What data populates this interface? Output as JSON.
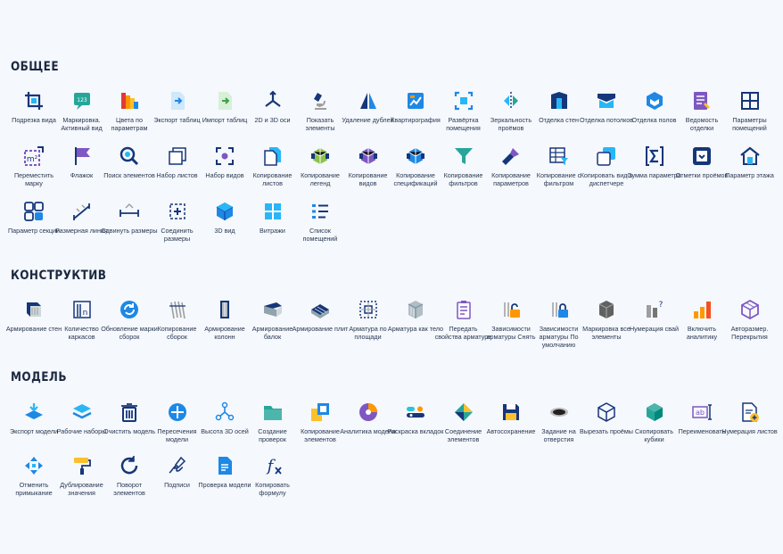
{
  "sections": [
    {
      "title": "ОБЩЕЕ",
      "tools": [
        {
          "label": "Подрезка вида",
          "icon": "crop-icon",
          "kind": "crop"
        },
        {
          "label": "Маркировка. Активный вид",
          "icon": "marking-icon",
          "kind": "badge123"
        },
        {
          "label": "Цвета по параметрам",
          "icon": "color-palette-icon",
          "kind": "palette"
        },
        {
          "label": "Экспорт таблиц",
          "icon": "export-table-icon",
          "kind": "docin"
        },
        {
          "label": "Импорт таблиц",
          "icon": "import-table-icon",
          "kind": "docout"
        },
        {
          "label": "2D и 3D оси",
          "icon": "axes-icon",
          "kind": "axes"
        },
        {
          "label": "Показать элементы",
          "icon": "microscope-icon",
          "kind": "microscope"
        },
        {
          "label": "Удаление дублей",
          "icon": "mirror-triangle-icon",
          "kind": "mirrortri"
        },
        {
          "label": "Квартирография",
          "icon": "apartment-chart-icon",
          "kind": "chart"
        },
        {
          "label": "Развёртка помещения",
          "icon": "room-unfold-icon",
          "kind": "unfold"
        },
        {
          "label": "Зеркальность проёмов",
          "icon": "mirror-opening-icon",
          "kind": "mirror"
        },
        {
          "label": "Отделка стен",
          "icon": "wall-finish-icon",
          "kind": "wallfin"
        },
        {
          "label": "Отделка потолков",
          "icon": "ceiling-finish-icon",
          "kind": "ceiling"
        },
        {
          "label": "Отделка полов",
          "icon": "floor-finish-icon",
          "kind": "floorfin"
        },
        {
          "label": "Ведомость отделки",
          "icon": "finish-schedule-icon",
          "kind": "schedule"
        },
        {
          "label": "Параметры помещений",
          "icon": "room-params-icon",
          "kind": "roomgrid"
        },
        {
          "label": "Переместить марку",
          "icon": "move-tag-icon",
          "kind": "m2"
        },
        {
          "label": "Флажок",
          "icon": "flag-icon",
          "kind": "flag"
        },
        {
          "label": "Поиск элементов",
          "icon": "search-icon",
          "kind": "search"
        },
        {
          "label": "Набор листов",
          "icon": "sheet-set-icon",
          "kind": "sheets"
        },
        {
          "label": "Набор видов",
          "icon": "view-set-icon",
          "kind": "views"
        },
        {
          "label": "Копирование листов",
          "icon": "copy-sheets-icon",
          "kind": "copydoc"
        },
        {
          "label": "Копирование легенд",
          "icon": "copy-legends-icon",
          "kind": "cube1"
        },
        {
          "label": "Копирование видов",
          "icon": "copy-views-icon",
          "kind": "cube2"
        },
        {
          "label": "Копирование спецификаций",
          "icon": "copy-specs-icon",
          "kind": "cube3"
        },
        {
          "label": "Копирование фильтров",
          "icon": "filter-icon",
          "kind": "filter"
        },
        {
          "label": "Копирование параметров",
          "icon": "brush-icon",
          "kind": "brush"
        },
        {
          "label": "Копирование с фильтром",
          "icon": "copy-filter-icon",
          "kind": "tablefilter"
        },
        {
          "label": "Копировать вид в диспетчере",
          "icon": "copy-view-manager-icon",
          "kind": "copyview"
        },
        {
          "label": "Сумма параметра",
          "icon": "sum-icon",
          "kind": "sum"
        },
        {
          "label": "Отметки проёмов",
          "icon": "opening-marks-icon",
          "kind": "marks"
        },
        {
          "label": "Параметр этажа",
          "icon": "level-house-icon",
          "kind": "house"
        },
        {
          "label": "Параметр секции",
          "icon": "section-param-icon",
          "kind": "section"
        },
        {
          "label": "Размерная линия",
          "icon": "dimension-line-icon",
          "kind": "dimline"
        },
        {
          "label": "Сдвинуть размеры",
          "icon": "shift-dims-icon",
          "kind": "shiftdim"
        },
        {
          "label": "Соединить размеры",
          "icon": "join-dims-icon",
          "kind": "joindim"
        },
        {
          "label": "3D вид",
          "icon": "3d-view-icon",
          "kind": "cube3d"
        },
        {
          "label": "Витражи",
          "icon": "curtain-wall-icon",
          "kind": "window"
        },
        {
          "label": "Список помещений",
          "icon": "room-list-icon",
          "kind": "list"
        }
      ]
    },
    {
      "title": "КОНСТРУКТИВ",
      "tools": [
        {
          "label": "Армирование стен",
          "icon": "wall-rebar-icon",
          "kind": "rebarwall"
        },
        {
          "label": "Количество каркасов",
          "icon": "frame-count-icon",
          "kind": "frames"
        },
        {
          "label": "Обновление марки сборок",
          "icon": "refresh-icon",
          "kind": "refresh"
        },
        {
          "label": "Копирование сборок",
          "icon": "copy-assembly-icon",
          "kind": "bars"
        },
        {
          "label": "Армирование колонн",
          "icon": "column-rebar-icon",
          "kind": "column"
        },
        {
          "label": "Армирование балок",
          "icon": "beam-rebar-icon",
          "kind": "beam"
        },
        {
          "label": "Армирование плит",
          "icon": "slab-rebar-icon",
          "kind": "slab"
        },
        {
          "label": "Арматура по площади",
          "icon": "area-rebar-icon",
          "kind": "arearebar"
        },
        {
          "label": "Арматура как тело",
          "icon": "rebar-solid-icon",
          "kind": "rebarsolid"
        },
        {
          "label": "Передать свойства арматуре",
          "icon": "transfer-props-icon",
          "kind": "transfer"
        },
        {
          "label": "Зависимости арматуры Снять",
          "icon": "unlock-icon",
          "kind": "unlock"
        },
        {
          "label": "Зависимости арматуры По умолчанию",
          "icon": "lock-icon",
          "kind": "lock"
        },
        {
          "label": "Маркировка все элементы",
          "icon": "mark-all-icon",
          "kind": "markall"
        },
        {
          "label": "Нумерация свай",
          "icon": "pile-number-icon",
          "kind": "piles"
        },
        {
          "label": "Включить аналитику",
          "icon": "analytics-bars-icon",
          "kind": "barchart"
        },
        {
          "label": "Авторазмер. Перекрытия",
          "icon": "auto-dim-slab-icon",
          "kind": "autodim"
        }
      ]
    },
    {
      "title": "МОДЕЛЬ",
      "tools": [
        {
          "label": "Экспорт модели",
          "icon": "export-model-icon",
          "kind": "exportlayers"
        },
        {
          "label": "Рабочие наборы",
          "icon": "worksets-icon",
          "kind": "layers"
        },
        {
          "label": "Очистить модель",
          "icon": "trash-icon",
          "kind": "trash"
        },
        {
          "label": "Пересечения модели",
          "icon": "intersections-icon",
          "kind": "crosshair"
        },
        {
          "label": "Высота 3D осей",
          "icon": "axis-height-icon",
          "kind": "axisheight"
        },
        {
          "label": "Создание проверок",
          "icon": "folder-icon",
          "kind": "folder"
        },
        {
          "label": "Копирование элементов",
          "icon": "copy-elements-icon",
          "kind": "copyel"
        },
        {
          "label": "Аналитика модели",
          "icon": "model-analytics-icon",
          "kind": "pie"
        },
        {
          "label": "Раскраска вкладок",
          "icon": "tab-color-icon",
          "kind": "tabcolor"
        },
        {
          "label": "Соединение элементов",
          "icon": "join-elements-icon",
          "kind": "diamond"
        },
        {
          "label": "Автосохранение",
          "icon": "save-icon",
          "kind": "save"
        },
        {
          "label": "Задание на отверстия",
          "icon": "hole-icon",
          "kind": "hole"
        },
        {
          "label": "Вырезать проёмы",
          "icon": "cut-openings-icon",
          "kind": "wirecube"
        },
        {
          "label": "Скопировать кубики",
          "icon": "copy-cubes-icon",
          "kind": "tealcube"
        },
        {
          "label": "Переименовать",
          "icon": "rename-icon",
          "kind": "rename"
        },
        {
          "label": "Нумерация листов",
          "icon": "sheet-number-icon",
          "kind": "docplus"
        },
        {
          "label": "Отменить примыкание",
          "icon": "unjoin-icon",
          "kind": "arrows"
        },
        {
          "label": "Дублирование значения",
          "icon": "roller-icon",
          "kind": "roller"
        },
        {
          "label": "Поворот элементов",
          "icon": "rotate-icon",
          "kind": "rotate"
        },
        {
          "label": "Подписи",
          "icon": "signature-icon",
          "kind": "sign"
        },
        {
          "label": "Проверка модели",
          "icon": "check-doc-icon",
          "kind": "bluedoc"
        },
        {
          "label": "Копировать формулу",
          "icon": "formula-icon",
          "kind": "formula"
        }
      ]
    }
  ]
}
